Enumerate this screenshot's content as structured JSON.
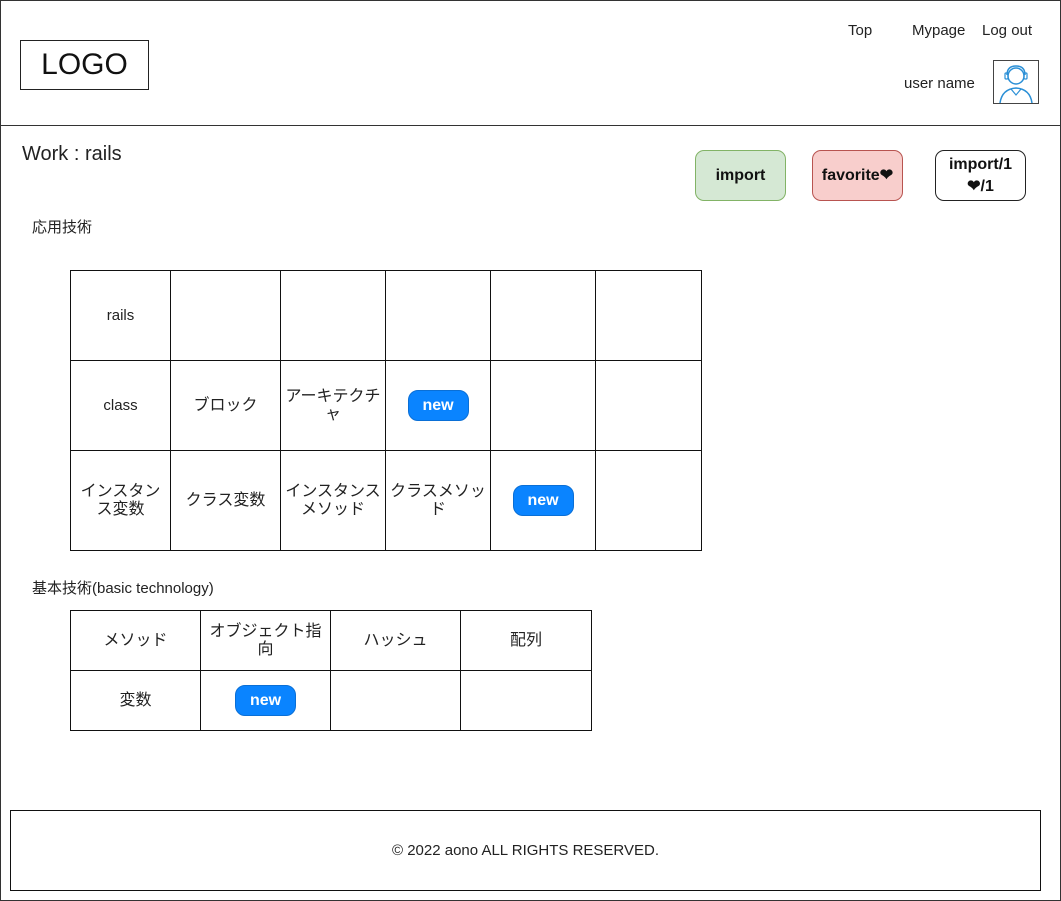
{
  "header": {
    "logo": "LOGO",
    "nav": {
      "top": "Top",
      "mypage": "Mypage",
      "logout": "Log out"
    },
    "user_name": "user name",
    "avatar_icon": "user-avatar-icon"
  },
  "main": {
    "title": "Work : rails",
    "buttons": {
      "import": "import",
      "favorite": "favorite❤",
      "count_line1": "import/1",
      "count_line2": "❤/1"
    },
    "applied": {
      "label": "応用技術",
      "rows": [
        [
          "rails",
          "",
          "",
          "",
          "",
          ""
        ],
        [
          "class",
          "ブロック",
          "アーキテクチャ",
          "new",
          "",
          ""
        ],
        [
          "インスタンス変数",
          "クラス変数",
          "インスタンスメソッド",
          "クラスメソッド",
          "new",
          ""
        ]
      ]
    },
    "basic": {
      "label": "基本技術(basic technology)",
      "rows": [
        [
          "メソッド",
          "オブジェクト指向",
          "ハッシュ",
          "配列"
        ],
        [
          "変数",
          "new",
          "",
          ""
        ]
      ]
    }
  },
  "footer": {
    "copyright": "© 2022 aono ALL RIGHTS RESERVED."
  },
  "colors": {
    "import_bg": "#d5e8d4",
    "favorite_bg": "#f8cecc",
    "new_badge": "#0a84ff"
  }
}
